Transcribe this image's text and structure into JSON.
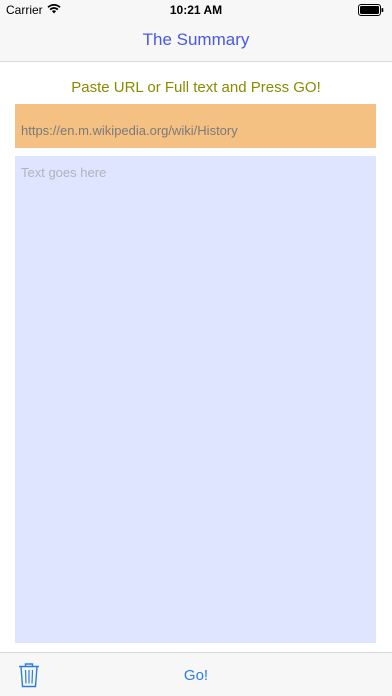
{
  "status_bar": {
    "carrier": "Carrier",
    "time": "10:21 AM",
    "wifi_icon": "wifi-icon",
    "battery_icon": "battery-icon"
  },
  "nav": {
    "title": "The Summary"
  },
  "main": {
    "prompt": "Paste URL or Full text and Press GO!",
    "url_field": {
      "value": "https://en.m.wikipedia.org/wiki/History",
      "placeholder": ""
    },
    "text_area": {
      "placeholder": "Text goes here"
    }
  },
  "toolbar": {
    "trash_icon": "trash-icon",
    "go_label": "Go!"
  },
  "colors": {
    "title": "#4a57e8",
    "prompt": "#8a8a00",
    "url_field_bg": "#f5c182",
    "text_area_bg": "#dfe5fe",
    "tint": "#2a7de0"
  }
}
